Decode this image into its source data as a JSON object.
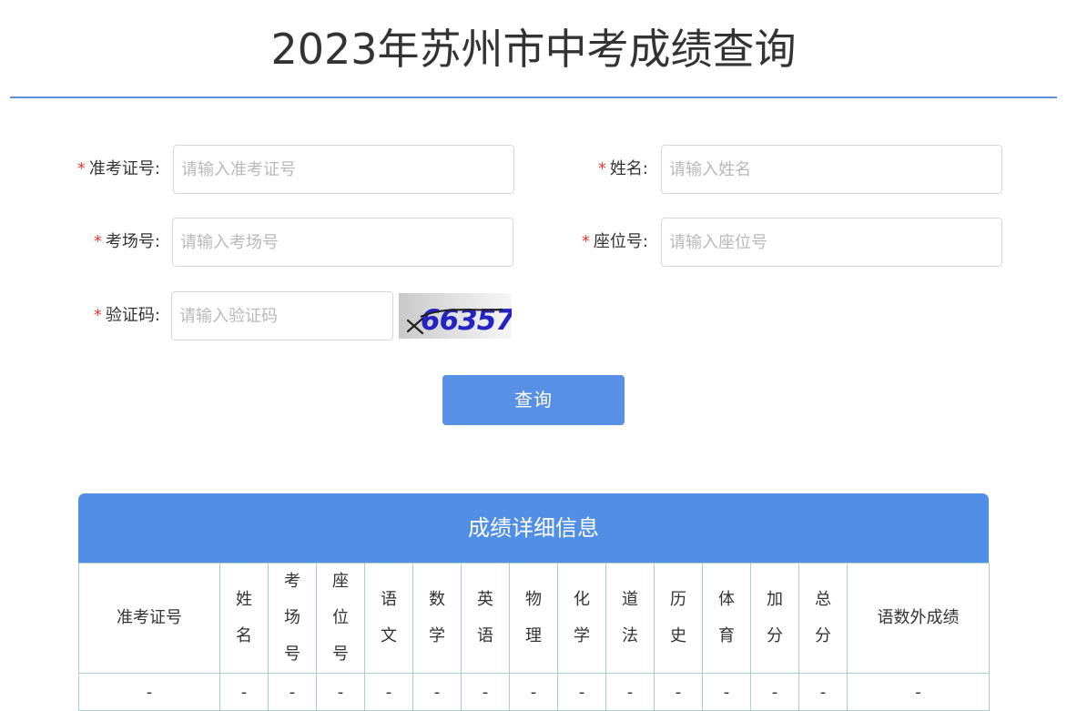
{
  "page": {
    "title": "2023年苏州市中考成绩查询"
  },
  "form": {
    "exam_id": {
      "label": "准考证号:",
      "placeholder": "请输入准考证号"
    },
    "name": {
      "label": "姓名:",
      "placeholder": "请输入姓名"
    },
    "room": {
      "label": "考场号:",
      "placeholder": "请输入考场号"
    },
    "seat": {
      "label": "座位号:",
      "placeholder": "请输入座位号"
    },
    "captcha": {
      "label": "验证码:",
      "placeholder": "请输入验证码",
      "image_text": "66357"
    },
    "required_mark": "*",
    "submit_label": "查询"
  },
  "result": {
    "title": "成绩详细信息",
    "columns": [
      "准考证号",
      "姓名",
      "考场号",
      "座位号",
      "语文",
      "数学",
      "英语",
      "物理",
      "化学",
      "道法",
      "历史",
      "体育",
      "加分",
      "总分",
      "语数外成绩"
    ],
    "row": [
      "-",
      "-",
      "-",
      "-",
      "-",
      "-",
      "-",
      "-",
      "-",
      "-",
      "-",
      "-",
      "-",
      "-",
      "-"
    ]
  },
  "colors": {
    "accent": "#5790e4",
    "required": "#e53935",
    "table_border": "#a9ced1"
  }
}
